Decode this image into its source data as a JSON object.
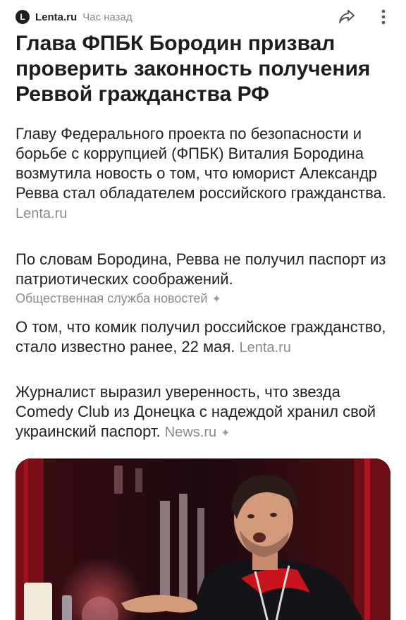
{
  "source": {
    "logo_letter": "L",
    "name": "Lenta.ru",
    "time": "Час назад"
  },
  "actions": {
    "share_icon": "share-icon",
    "more_icon": "more-vertical-icon"
  },
  "article": {
    "title": "Глава ФПБК Бородин призвал проверить законность получения Реввой гражданства РФ",
    "paragraphs": [
      {
        "text": "Главу Федерального проекта по безопасности и борьбе с коррупцией (ФПБК) Виталия Бородина возмутила новость о том, что юморист Александр Ревва стал обладателем российского гражданства.",
        "source": "Lenta.ru"
      },
      {
        "text": "По словам Бородина, Ревва не получил паспорт из патриотических соображений.",
        "source": "Общественная служба новостей"
      },
      {
        "text": "О том, что комик получил российское гражданство, стало известно ранее, 22 мая.",
        "source": "Lenta.ru"
      },
      {
        "text": "Журналист выразил уверенность, что звезда Comedy Club из Донецка с надеждой хранил свой украинский паспорт.",
        "source": "News.ru"
      }
    ]
  },
  "colors": {
    "background": "#ffffff",
    "title": "#1d1d1d",
    "body": "#222222",
    "source": "#8b8b8b",
    "photo_backdrop": "#2a0c10"
  }
}
